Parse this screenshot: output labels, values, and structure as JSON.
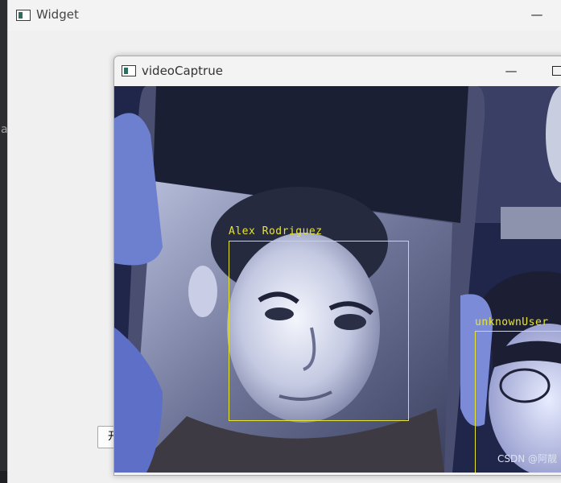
{
  "background": {
    "clipped_letter": "a"
  },
  "widget": {
    "title": "Widget",
    "minimize_glyph": "—",
    "button_label": "开"
  },
  "video_window": {
    "title": "videoCaptrue",
    "minimize_glyph": "—"
  },
  "detections": [
    {
      "label": "Alex Rodriguez"
    },
    {
      "label": "unknownUser"
    }
  ],
  "watermark": "CSDN @阿靓",
  "colors": {
    "box": "#e7e430",
    "titlebar": "#f3f3f3"
  }
}
